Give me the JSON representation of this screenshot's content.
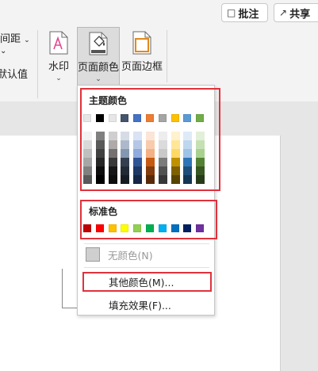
{
  "header": {
    "comment_label": "批注",
    "share_label": "共享"
  },
  "ribbon": {
    "fragment_spacing": "间距",
    "fragment_default": "默认值",
    "watermark_label": "水印",
    "page_color_label": "页面颜色",
    "page_border_label": "页面边框"
  },
  "dropdown": {
    "theme_colors_label": "主题颜色",
    "standard_colors_label": "标准色",
    "no_color_label": "无颜色(N)",
    "more_colors_label": "其他颜色(M)...",
    "fill_effects_label": "填充效果(F)...",
    "theme_top_row": [
      "#e7e6e6",
      "#000000",
      "#e7e6e6",
      "#44546a",
      "#4472c4",
      "#ed7d31",
      "#a5a5a5",
      "#ffc000",
      "#5b9bd5",
      "#70ad47"
    ],
    "theme_shades": [
      [
        "#f2f2f2",
        "#d9d9d9",
        "#bfbfbf",
        "#a6a6a6",
        "#808080",
        "#595959"
      ],
      [
        "#7f7f7f",
        "#595959",
        "#404040",
        "#262626",
        "#0d0d0d",
        "#000000"
      ],
      [
        "#d0cece",
        "#aeaaaa",
        "#757171",
        "#3a3838",
        "#171616",
        "#0d0d0d"
      ],
      [
        "#d6dce5",
        "#adb9ca",
        "#8497b0",
        "#333f50",
        "#222a35",
        "#161c24"
      ],
      [
        "#dae3f3",
        "#b4c7e7",
        "#8faadc",
        "#2f5597",
        "#1f3864",
        "#152646"
      ],
      [
        "#fbe5d6",
        "#f8cbad",
        "#f4b183",
        "#c55a11",
        "#843c0c",
        "#5a2a08"
      ],
      [
        "#ededed",
        "#dbdbdb",
        "#c9c9c9",
        "#7b7b7b",
        "#525252",
        "#383838"
      ],
      [
        "#fff2cc",
        "#ffe699",
        "#ffd966",
        "#bf9000",
        "#7f6000",
        "#594300"
      ],
      [
        "#deebf7",
        "#bdd7ee",
        "#9dc3e6",
        "#2e75b6",
        "#1f4e79",
        "#153654"
      ],
      [
        "#e2f0d9",
        "#c5e0b4",
        "#a9d18e",
        "#548235",
        "#385723",
        "#263c18"
      ]
    ],
    "standard_colors": [
      "#c00000",
      "#ff0000",
      "#ffc000",
      "#ffff00",
      "#92d050",
      "#00b050",
      "#00b0f0",
      "#0070c0",
      "#002060",
      "#7030a0"
    ]
  }
}
